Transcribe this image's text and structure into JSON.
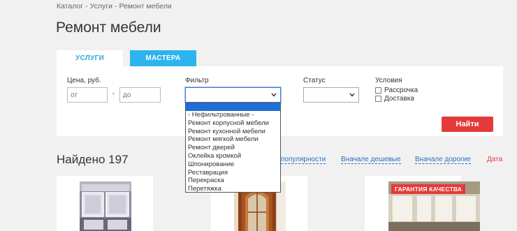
{
  "breadcrumb": {
    "items": [
      "Каталог",
      "Услуги",
      "Ремонт мебели"
    ],
    "separator": "-"
  },
  "page_title": "Ремонт мебели",
  "tabs": [
    {
      "label": "УСЛУГИ",
      "active": true
    },
    {
      "label": "МАСТЕРА",
      "active": false
    }
  ],
  "filters": {
    "price": {
      "label": "Цена, руб.",
      "from_placeholder": "от",
      "to_placeholder": "до",
      "dash": "-"
    },
    "filter": {
      "label": "Фильтр",
      "value": ""
    },
    "status": {
      "label": "Статус",
      "value": ""
    },
    "conditions": {
      "label": "Условия",
      "options": [
        "Рассрочка",
        "Доставка"
      ]
    },
    "submit_label": "Найти"
  },
  "dropdown": {
    "options": [
      "- Нефильтрованные -",
      "Ремонт корпусной мебели",
      "Ремонт кухонной мебели",
      "Ремонт мягкой мебели",
      "Ремонт дверей",
      "Оклейка кромкой",
      "Шпонирование",
      "Реставрация",
      "Перекраска",
      "Перетяжка"
    ]
  },
  "results": {
    "found_text": "Найдено 197",
    "sort": {
      "popular": "популярности",
      "cheap": "Вначале дешевые",
      "expensive": "Вначале дорогие",
      "date": "Дата"
    }
  },
  "cards": [
    {
      "badge": ""
    },
    {
      "badge": ""
    },
    {
      "badge": "ГАРАНТИЯ КАЧЕСТВА"
    }
  ],
  "colors": {
    "accent_blue": "#2cb4ef",
    "accent_red": "#e53a3a",
    "link_blue": "#2a6fba",
    "dropdown_highlight": "#1e6fd9"
  }
}
